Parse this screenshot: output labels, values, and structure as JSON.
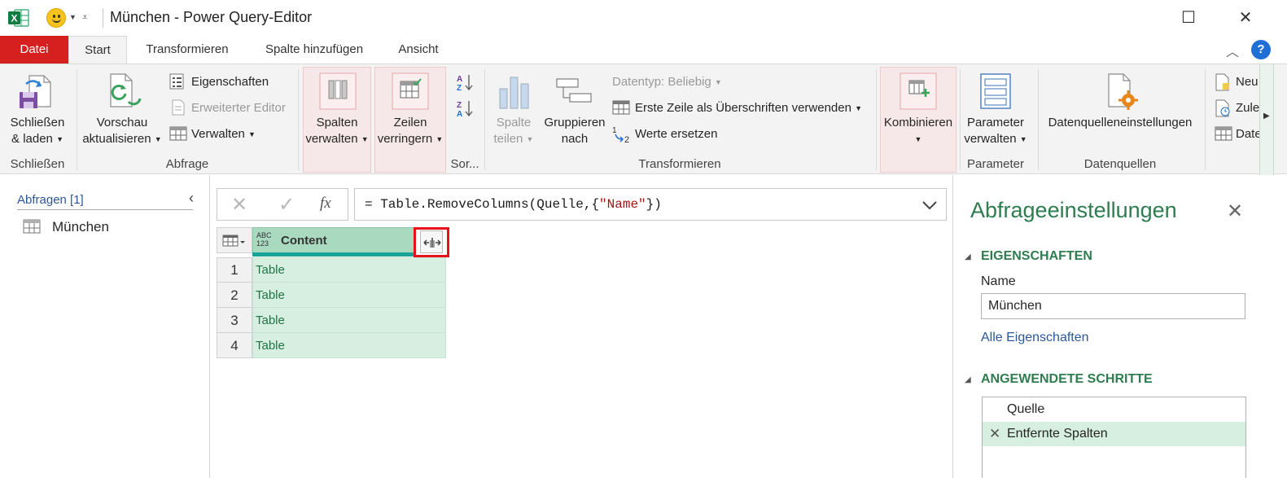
{
  "window": {
    "title": "München - Power Query-Editor",
    "buttons": {
      "maximize": "☐",
      "close": "✕"
    }
  },
  "tabs": [
    {
      "label": "Datei"
    },
    {
      "label": "Start"
    },
    {
      "label": "Transformieren"
    },
    {
      "label": "Spalte hinzufügen"
    },
    {
      "label": "Ansicht"
    }
  ],
  "help": "?",
  "ribbon": {
    "close_group": {
      "label": "Schließen",
      "close_load_l1": "Schließen",
      "close_load_l2": "& laden"
    },
    "query_group": {
      "label": "Abfrage",
      "refresh_l1": "Vorschau",
      "refresh_l2": "aktualisieren",
      "properties": "Eigenschaften",
      "advanced_editor": "Erweiterter Editor",
      "manage": "Verwalten"
    },
    "columns_group": {
      "manage_cols_l1": "Spalten",
      "manage_cols_l2": "verwalten",
      "reduce_rows_l1": "Zeilen",
      "reduce_rows_l2": "verringern"
    },
    "sort_group": {
      "label": "Sor..."
    },
    "transform_group": {
      "label": "Transformieren",
      "split_l1": "Spalte",
      "split_l2": "teilen",
      "group_l1": "Gruppieren",
      "group_l2": "nach",
      "datatype": "Datentyp: Beliebig",
      "first_row": "Erste Zeile als Überschriften verwenden",
      "replace_values": "Werte ersetzen"
    },
    "combine_group": {
      "combine": "Kombinieren"
    },
    "parameters_group": {
      "label": "Parameter",
      "manage_params_l1": "Parameter",
      "manage_params_l2": "verwalten"
    },
    "datasources_group": {
      "label": "Datenquellen",
      "settings": "Datenquelleneinstellungen"
    },
    "new_query_group": {
      "new": "Neu",
      "recent": "Zule",
      "enter": "Date"
    }
  },
  "queries_pane": {
    "header": "Abfragen [1]",
    "items": [
      {
        "label": "München"
      }
    ]
  },
  "formula_bar": {
    "fx": "fx",
    "prefix": "= Table.RemoveColumns(Quelle,{",
    "string": "\"Name\"",
    "suffix": "})"
  },
  "grid": {
    "column_type": "ABC 123",
    "column_header": "Content",
    "rows": [
      {
        "index": "1",
        "value": "Table"
      },
      {
        "index": "2",
        "value": "Table"
      },
      {
        "index": "3",
        "value": "Table"
      },
      {
        "index": "4",
        "value": "Table"
      }
    ]
  },
  "settings_pane": {
    "title": "Abfrageeinstellungen",
    "properties_header": "EIGENSCHAFTEN",
    "name_label": "Name",
    "name_value": "München",
    "all_properties": "Alle Eigenschaften",
    "steps_header": "ANGEWENDETE SCHRITTE",
    "steps": [
      {
        "label": "Quelle"
      },
      {
        "label": "Entfernte Spalten"
      }
    ]
  },
  "colors": {
    "file_tab": "#d6201f",
    "accent_green": "#217346",
    "grid_fill": "#d6efe1",
    "header_fill": "#a9d9bf",
    "highlight_red": "#e8101a",
    "link_blue": "#2b579a"
  }
}
